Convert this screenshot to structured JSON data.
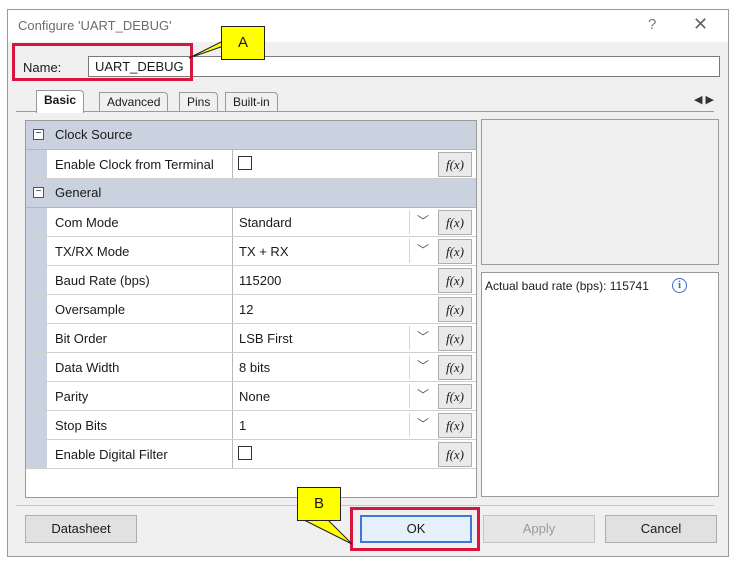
{
  "window": {
    "title": "Configure 'UART_DEBUG'",
    "help_glyph": "?",
    "close_glyph": "✕"
  },
  "name_field": {
    "label": "Name:",
    "value": "UART_DEBUG"
  },
  "tabs": [
    {
      "label": "Basic",
      "active": true
    },
    {
      "label": "Advanced",
      "active": false
    },
    {
      "label": "Pins",
      "active": false
    },
    {
      "label": "Built-in",
      "active": false
    }
  ],
  "tab_arrows": "◀▶",
  "properties": {
    "categories": [
      {
        "label": "Clock Source",
        "expander": "−"
      },
      {
        "label": "General",
        "expander": "−"
      }
    ],
    "rows": [
      {
        "name": "Enable Clock from Terminal",
        "kind": "checkbox",
        "checked": false
      },
      {
        "name": "Com Mode",
        "kind": "dropdown",
        "value": "Standard"
      },
      {
        "name": "TX/RX Mode",
        "kind": "dropdown",
        "value": "TX + RX"
      },
      {
        "name": "Baud Rate (bps)",
        "kind": "text",
        "value": "115200"
      },
      {
        "name": "Oversample",
        "kind": "text",
        "value": "12"
      },
      {
        "name": "Bit Order",
        "kind": "dropdown",
        "value": "LSB First"
      },
      {
        "name": "Data Width",
        "kind": "dropdown",
        "value": "8 bits"
      },
      {
        "name": "Parity",
        "kind": "dropdown",
        "value": "None"
      },
      {
        "name": "Stop Bits",
        "kind": "dropdown",
        "value": "1"
      },
      {
        "name": "Enable Digital Filter",
        "kind": "checkbox",
        "checked": false
      }
    ],
    "fx_label": "f(x)",
    "dropdown_glyph": "﹀"
  },
  "info_panel": {
    "baud_text": "Actual baud rate (bps): 115741",
    "info_glyph": "i"
  },
  "buttons": {
    "datasheet": "Datasheet",
    "ok": "OK",
    "apply": "Apply",
    "cancel": "Cancel"
  },
  "callouts": {
    "a": "A",
    "b": "B"
  },
  "colors": {
    "highlight": "#d6163f",
    "callout": "#ffff00",
    "category_band": "#c9d2de",
    "default_button": "#3a7ad6"
  }
}
